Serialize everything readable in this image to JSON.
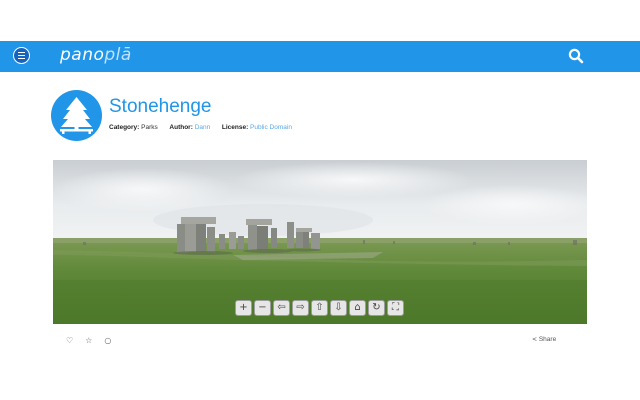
{
  "header": {
    "logo_main": "pano",
    "logo_accent": "plā",
    "menu_icon": "menu-icon",
    "search_icon": "search-icon",
    "bar_color": "#2196e8"
  },
  "listing": {
    "title": "Stonehenge",
    "category_label": "Category:",
    "category_value": "Parks",
    "author_label": "Author:",
    "author_value": "Dann",
    "license_label": "License:",
    "license_value": "Public Domain",
    "avatar_icon": "tree-picnic-icon"
  },
  "viewer": {
    "controls": [
      {
        "name": "zoom-in-button",
        "glyph": "+"
      },
      {
        "name": "zoom-out-button",
        "glyph": "−"
      },
      {
        "name": "pan-left-button",
        "glyph": "⇦"
      },
      {
        "name": "pan-right-button",
        "glyph": "⇨"
      },
      {
        "name": "pan-up-button",
        "glyph": "⇧"
      },
      {
        "name": "pan-down-button",
        "glyph": "⇩"
      },
      {
        "name": "home-view-button",
        "glyph": "⌂"
      },
      {
        "name": "rotate-button",
        "glyph": "↻"
      },
      {
        "name": "fullscreen-button",
        "glyph": "⛶"
      }
    ]
  },
  "actions": {
    "like_icon": "♡",
    "favorite_icon": "☆",
    "comment_icon": "○",
    "share_icon": "<",
    "share_label": "Share"
  }
}
